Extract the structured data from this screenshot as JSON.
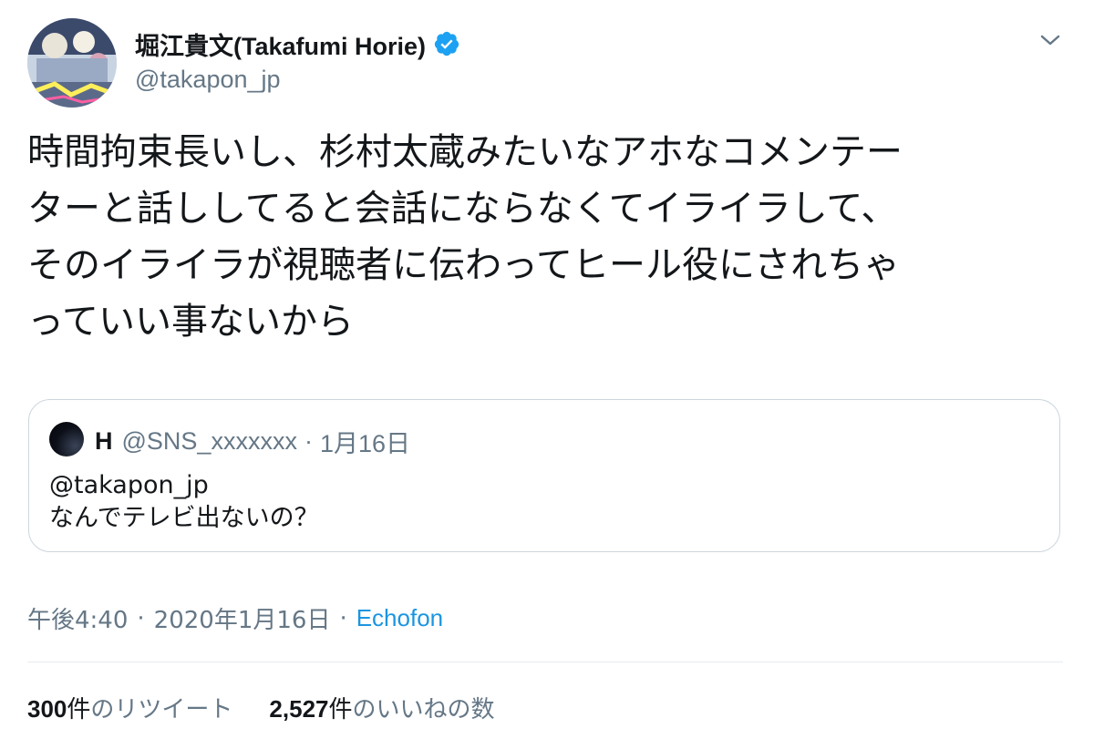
{
  "author": {
    "display_name": "堀江貴文(Takafumi Horie)",
    "handle": "@takapon_jp",
    "verified": true
  },
  "tweet": {
    "text": "時間拘束長いし、杉村太蔵みたいなアホなコメンテー\nターと話ししてると会話にならなくてイライラして、\nそのイライラが視聴者に伝わってヒール役にされちゃ\nっていい事ないから"
  },
  "quote": {
    "name": "H",
    "handle": "@SNS_xxxxxxx",
    "separator": "·",
    "date": "1月16日",
    "lines": [
      "@takapon_jp",
      "なんでテレビ出ないの？"
    ]
  },
  "meta": {
    "time": "午後4:40",
    "separator": "·",
    "date": "2020年1月16日",
    "source": "Echofon"
  },
  "stats": {
    "retweets": {
      "count": "300",
      "unit": "件",
      "label": "のリツイート"
    },
    "likes": {
      "count": "2,527",
      "unit": "件",
      "label": "のいいねの数"
    }
  },
  "icons": {
    "verified": "verified-badge-icon",
    "caret": "chevron-down-icon"
  },
  "colors": {
    "link": "#1b95e0",
    "secondary_text": "#657786",
    "primary_text": "#14171a",
    "verified": "#1da1f2",
    "border": "#ccd6dd"
  }
}
